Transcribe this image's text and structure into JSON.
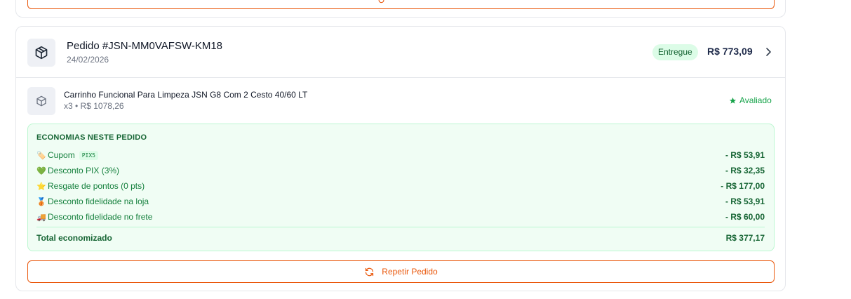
{
  "order": {
    "title": "Pedido #JSN-MM0VAFSW-KM18",
    "date": "24/02/2026",
    "status": "Entregue",
    "total": "R$ 773,09"
  },
  "item": {
    "name": "Carrinho Funcional Para Limpeza JSN G8 Com 2 Cesto 40/60 LT",
    "meta": "x3 • R$ 1078,26",
    "rating_label": "Avaliado"
  },
  "savings": {
    "title": "ECONOMIAS NESTE PEDIDO",
    "rows": [
      {
        "icon": "tag-icon",
        "emoji": "🏷️",
        "label": "Cupom",
        "tag": "PIX5",
        "amount": "- R$ 53,91"
      },
      {
        "icon": "heart-icon",
        "emoji": "💚",
        "label": "Desconto PIX (3%)",
        "amount": "- R$ 32,35"
      },
      {
        "icon": "star-icon",
        "emoji": "⭐",
        "label": "Resgate de pontos (0 pts)",
        "amount": "- R$ 177,00"
      },
      {
        "icon": "medal-icon",
        "emoji": "🥉",
        "label": "Desconto fidelidade na loja",
        "amount": "- R$ 53,91"
      },
      {
        "icon": "truck-icon",
        "emoji": "🚚",
        "label": "Desconto fidelidade no frete",
        "amount": "- R$ 60,00"
      }
    ],
    "total_label": "Total economizado",
    "total_amount": "R$ 377,17"
  },
  "actions": {
    "repeat_label": "Repetir Pedido"
  },
  "colors": {
    "accent": "#ea580c",
    "success": "#16a34a",
    "savings_bg": "#f0fdf4",
    "status_bg": "#dcfce7",
    "price": "#1e2a4a"
  }
}
